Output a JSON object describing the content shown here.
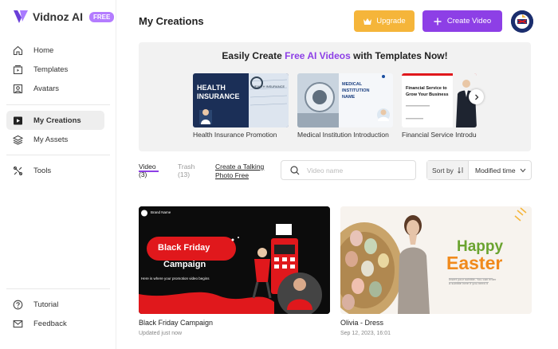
{
  "app": {
    "name": "Vidnoz AI",
    "badge": "FREE"
  },
  "sidebar": {
    "items": [
      {
        "label": "Home",
        "icon": "home-icon"
      },
      {
        "label": "Templates",
        "icon": "templates-icon"
      },
      {
        "label": "Avatars",
        "icon": "avatar-icon"
      },
      {
        "label": "My Creations",
        "icon": "play-icon",
        "active": true
      },
      {
        "label": "My Assets",
        "icon": "layers-icon"
      },
      {
        "label": "Tools",
        "icon": "tools-icon"
      },
      {
        "label": "Tutorial",
        "icon": "help-icon"
      },
      {
        "label": "Feedback",
        "icon": "mail-icon"
      }
    ]
  },
  "header": {
    "title": "My Creations",
    "upgrade_label": "Upgrade",
    "create_label": "Create Video"
  },
  "banner": {
    "title_prefix": "Easily Create ",
    "title_highlight": "Free AI Videos",
    "title_suffix": " with Templates Now!",
    "templates": [
      {
        "caption": "Health Insurance Promotion",
        "thumb_line1": "HEALTH",
        "thumb_line2": "INSURANCE",
        "thumb_tag": "HEALTH INSURANCE"
      },
      {
        "caption": "Medical Institution Introduction",
        "thumb_line1": "MEDICAL",
        "thumb_line2": "INSTITUTION",
        "thumb_line3": "NAME"
      },
      {
        "caption": "Financial Service Introduction",
        "thumb_line1": "Financial Service to",
        "thumb_line2": "Grow Your Business"
      }
    ]
  },
  "tabs": [
    {
      "label": "Video",
      "count": "(3)",
      "active": true
    },
    {
      "label": "Trash",
      "count": "(13)",
      "active": false
    }
  ],
  "talking_photo_link": {
    "line1": "Create a Talking",
    "line2": "Photo Free"
  },
  "search": {
    "placeholder": "Video name"
  },
  "sort": {
    "label": "Sort by",
    "value": "Modified time"
  },
  "videos": [
    {
      "title": "Black Friday Campaign",
      "date": "Updated just now",
      "thumb": {
        "brand": "Brand Name",
        "line1": "Black Friday",
        "line2": "Campaign",
        "sub": "Here is where your promotion video begins"
      }
    },
    {
      "title": "Olivia - Dress",
      "date": "Sep 12, 2023, 16:01",
      "thumb": {
        "line1": "Happy",
        "line2": "Easter",
        "sub": "Insert your subtitle. You can enter a subtitle here if you need it"
      }
    }
  ],
  "colors": {
    "accent": "#8d3fe6",
    "upgrade": "#f5b53a",
    "red": "#e0181c"
  }
}
